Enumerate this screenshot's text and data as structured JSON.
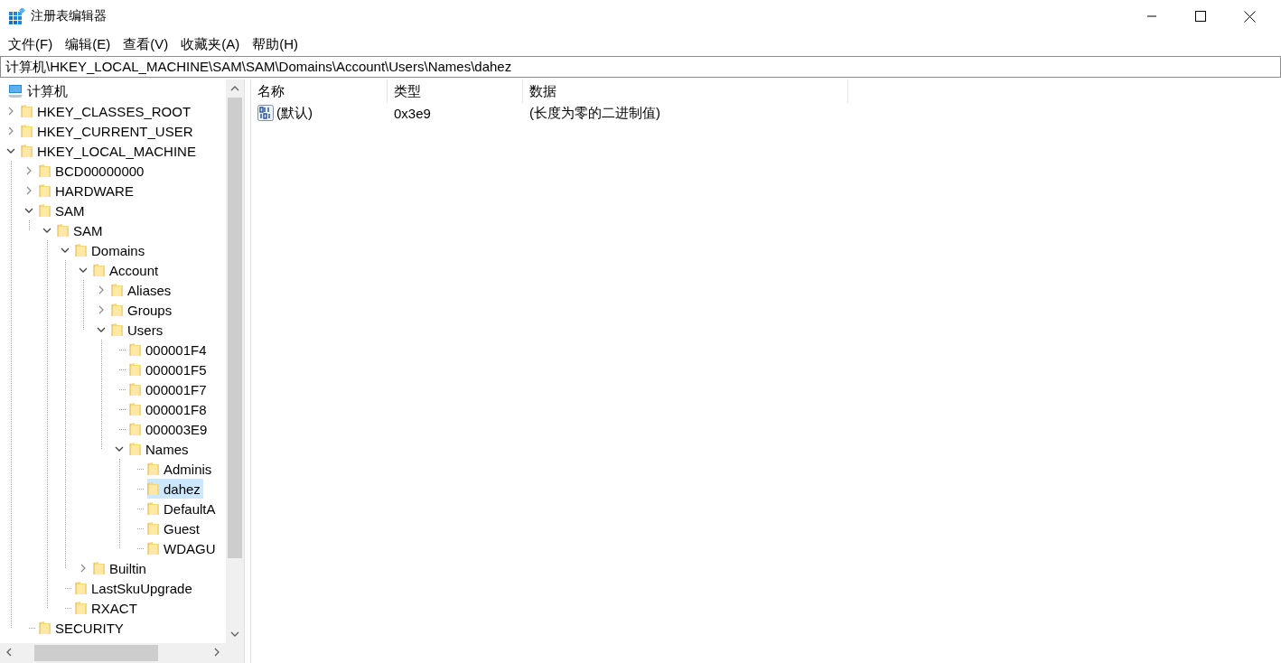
{
  "window": {
    "title": "注册表编辑器"
  },
  "menu": [
    {
      "label": "文件(F)"
    },
    {
      "label": "编辑(E)"
    },
    {
      "label": "查看(V)"
    },
    {
      "label": "收藏夹(A)"
    },
    {
      "label": "帮助(H)"
    }
  ],
  "address": "计算机\\HKEY_LOCAL_MACHINE\\SAM\\SAM\\Domains\\Account\\Users\\Names\\dahez",
  "tree": {
    "root": "计算机",
    "items": [
      {
        "label": "HKEY_CLASSES_ROOT",
        "expanded": false,
        "selected": false
      },
      {
        "label": "HKEY_CURRENT_USER",
        "expanded": false,
        "selected": false
      },
      {
        "label": "HKEY_LOCAL_MACHINE",
        "expanded": true,
        "selected": false,
        "children": [
          {
            "label": "BCD00000000",
            "expanded": false,
            "selected": false
          },
          {
            "label": "HARDWARE",
            "expanded": false,
            "selected": false
          },
          {
            "label": "SAM",
            "expanded": true,
            "selected": false,
            "children": [
              {
                "label": "SAM",
                "expanded": true,
                "selected": false,
                "children": [
                  {
                    "label": "Domains",
                    "expanded": true,
                    "selected": false,
                    "children": [
                      {
                        "label": "Account",
                        "expanded": true,
                        "selected": false,
                        "children": [
                          {
                            "label": "Aliases",
                            "expanded": false,
                            "selected": false
                          },
                          {
                            "label": "Groups",
                            "expanded": false,
                            "selected": false
                          },
                          {
                            "label": "Users",
                            "expanded": true,
                            "selected": false,
                            "children": [
                              {
                                "label": "000001F4",
                                "selected": false
                              },
                              {
                                "label": "000001F5",
                                "selected": false
                              },
                              {
                                "label": "000001F7",
                                "selected": false
                              },
                              {
                                "label": "000001F8",
                                "selected": false
                              },
                              {
                                "label": "000003E9",
                                "selected": false
                              },
                              {
                                "label": "Names",
                                "expanded": true,
                                "selected": false,
                                "children": [
                                  {
                                    "label": "Adminis",
                                    "selected": false
                                  },
                                  {
                                    "label": "dahez",
                                    "selected": true
                                  },
                                  {
                                    "label": "DefaultA",
                                    "selected": false
                                  },
                                  {
                                    "label": "Guest",
                                    "selected": false
                                  },
                                  {
                                    "label": "WDAGU",
                                    "selected": false
                                  }
                                ]
                              }
                            ]
                          }
                        ]
                      },
                      {
                        "label": "Builtin",
                        "expanded": false,
                        "selected": false
                      }
                    ]
                  },
                  {
                    "label": "LastSkuUpgrade",
                    "selected": false
                  },
                  {
                    "label": "RXACT",
                    "selected": false
                  }
                ]
              }
            ]
          },
          {
            "label": "SECURITY",
            "selected": false
          }
        ]
      }
    ]
  },
  "list": {
    "columns": [
      "名称",
      "类型",
      "数据"
    ],
    "rows": [
      {
        "name": "(默认)",
        "type": "0x3e9",
        "data": "(长度为零的二进制值)"
      }
    ]
  }
}
